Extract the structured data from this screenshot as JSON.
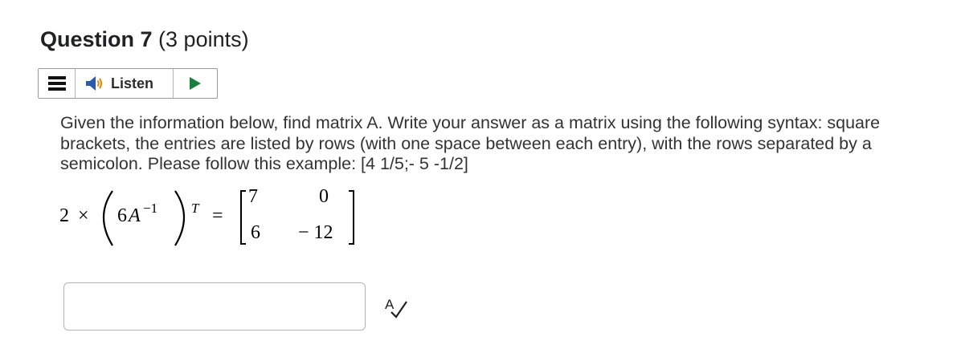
{
  "question": {
    "title": "Question 7",
    "points": "(3 points)"
  },
  "listen_bar": {
    "menu_icon": "hamburger-menu-icon",
    "speaker_icon": "speaker-icon",
    "listen_label": "Listen",
    "play_icon": "play-icon"
  },
  "prompt": {
    "text": "Given the information below, find matrix A. Write your answer as a matrix using the following syntax: square brackets, the entries are listed by rows (with one space between each entry), with the rows separated by a semicolon. Please follow this example: [4 1/5;- 5 -1/2]"
  },
  "equation": {
    "coefficient": "2",
    "times": "×",
    "inner_coefficient": "6",
    "variable": "A",
    "inverse_exponent": "−1",
    "transpose_exponent": "T",
    "equals": "=",
    "matrix": {
      "row1": [
        "7",
        "0"
      ],
      "row2": [
        "6",
        "− 12"
      ]
    }
  },
  "answer": {
    "value": "",
    "placeholder": ""
  },
  "spellcheck_icon": "spell-check-icon",
  "colors": {
    "text": "#333333",
    "heading": "#202122",
    "border": "#b5b5b5",
    "play_green": "#1a7f3a",
    "speaker_orange": "#e08a00",
    "speaker_blue": "#2b5cab"
  }
}
